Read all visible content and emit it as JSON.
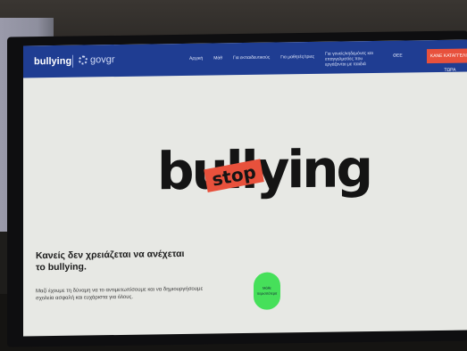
{
  "nav": {
    "logo": "bullying",
    "gov_logo": "govgr",
    "items": [
      "Αρχική",
      "Μάθ",
      "Για εκπαιδευτικούς",
      "Για μαθητές/τριες",
      "Για γονείς/κηδεμόνες και επαγγελματίες που εργάζονται με παιδιά",
      "ΘΕΕ"
    ],
    "cta": "ΚΑΝΕ ΚΑΤΑΓΓΕΛΙΑ ΤΩΡΑ"
  },
  "hero": {
    "word": "bullying",
    "stop": "stop"
  },
  "content": {
    "headline": "Κανείς δεν χρειάζεται να ανέχεται το bullying.",
    "body": "Μαζί έχουμε τη δύναμη να το αντιμετωπίσουμε και να δημιουργήσουμε σχολεία ασφαλή και ευχάριστα για όλους.",
    "green_button": "Μάθε περισσότερα"
  },
  "colors": {
    "nav_bg": "#1f3d92",
    "accent_red": "#e8513c",
    "accent_green": "#46e05a",
    "page_bg": "#e7e8e4"
  }
}
